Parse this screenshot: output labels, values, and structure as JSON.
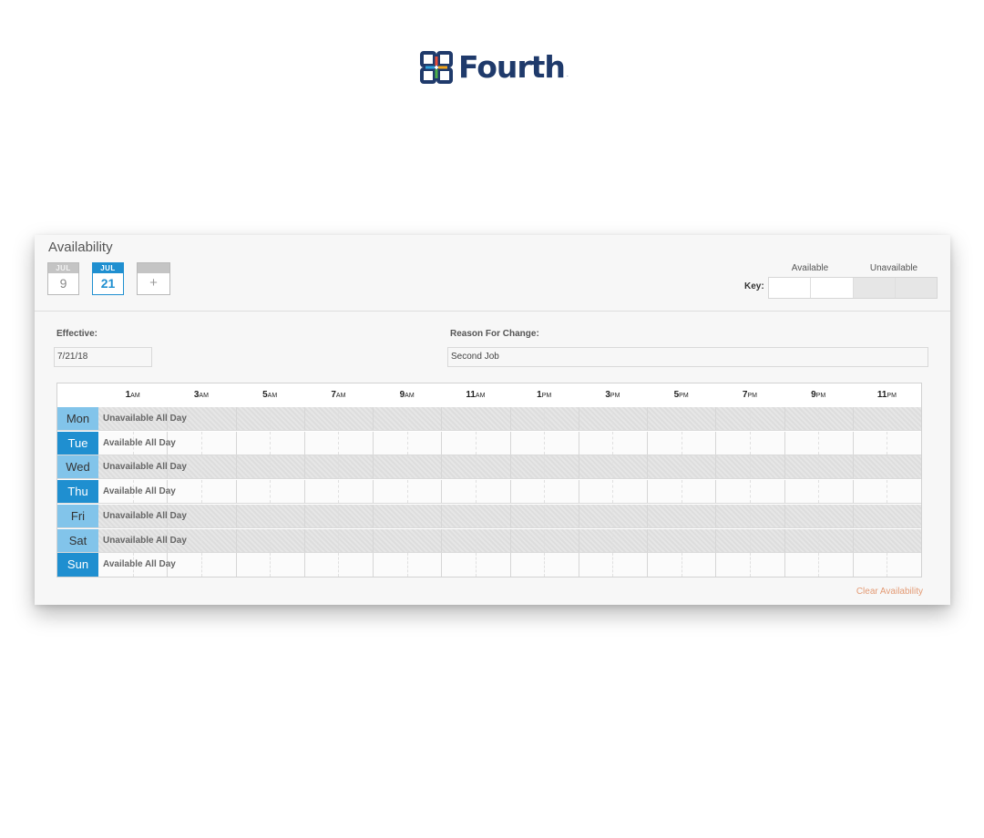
{
  "brand": {
    "name": "Fourth",
    "reg": "."
  },
  "availability": {
    "title": "Availability",
    "date_tabs": [
      {
        "month": "JUL",
        "day": "9",
        "active": false
      },
      {
        "month": "JUL",
        "day": "21",
        "active": true
      },
      {
        "month": "",
        "day": "+",
        "active": false
      }
    ],
    "key": {
      "label": "Key:",
      "available_label": "Available",
      "unavailable_label": "Unavailable"
    },
    "effective": {
      "label": "Effective:",
      "value": "7/21/18"
    },
    "reason": {
      "label": "Reason For Change:",
      "value": "Second Job"
    },
    "time_labels": [
      {
        "hour": "1",
        "suffix": "AM"
      },
      {
        "hour": "3",
        "suffix": "AM"
      },
      {
        "hour": "5",
        "suffix": "AM"
      },
      {
        "hour": "7",
        "suffix": "AM"
      },
      {
        "hour": "9",
        "suffix": "AM"
      },
      {
        "hour": "11",
        "suffix": "AM"
      },
      {
        "hour": "1",
        "suffix": "PM"
      },
      {
        "hour": "3",
        "suffix": "PM"
      },
      {
        "hour": "5",
        "suffix": "PM"
      },
      {
        "hour": "7",
        "suffix": "PM"
      },
      {
        "hour": "9",
        "suffix": "PM"
      },
      {
        "hour": "11",
        "suffix": "PM"
      }
    ],
    "days": [
      {
        "label": "Mon",
        "status": "Unavailable All Day",
        "available": false
      },
      {
        "label": "Tue",
        "status": "Available All Day",
        "available": true
      },
      {
        "label": "Wed",
        "status": "Unavailable All Day",
        "available": false
      },
      {
        "label": "Thu",
        "status": "Available All Day",
        "available": true
      },
      {
        "label": "Fri",
        "status": "Unavailable All Day",
        "available": false
      },
      {
        "label": "Sat",
        "status": "Unavailable All Day",
        "available": false
      },
      {
        "label": "Sun",
        "status": "Available All Day",
        "available": true
      }
    ],
    "clear_label": "Clear Availability"
  }
}
